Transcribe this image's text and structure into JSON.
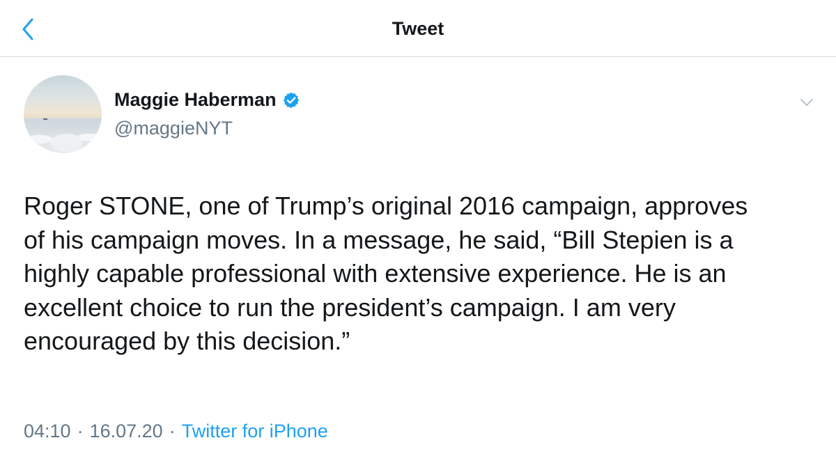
{
  "header": {
    "title": "Tweet",
    "back_icon": "chevron-left-icon"
  },
  "tweet": {
    "author": {
      "name": "Maggie Haberman",
      "handle": "@maggieNYT",
      "verified": true,
      "verified_icon": "verified-badge-icon"
    },
    "more_icon": "chevron-down-icon",
    "text": "Roger STONE, one of Trump’s original 2016 campaign, approves\nof his campaign moves. In a message, he said, “Bill Stepien is a\nhighly capable professional with extensive experience. He is an\nexcellent choice to run the president’s campaign. I am very\nencouraged by this decision.”",
    "time": "04:10",
    "separator": "·",
    "date": "16.07.20",
    "source": "Twitter for iPhone"
  },
  "colors": {
    "accent": "#1da1f2",
    "text_primary": "#14171a",
    "text_secondary": "#657786",
    "divider": "#d6dbdf"
  }
}
